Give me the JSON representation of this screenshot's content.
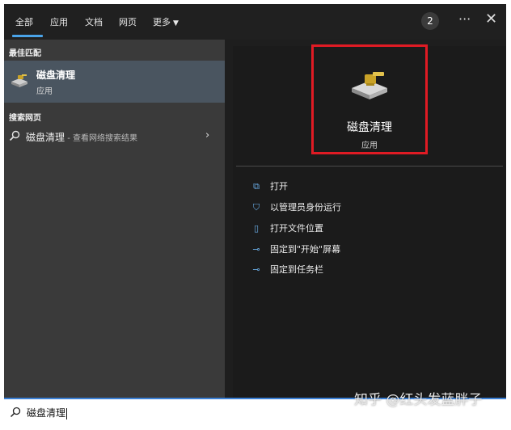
{
  "tabs": [
    {
      "label": "全部"
    },
    {
      "label": "应用"
    },
    {
      "label": "文档"
    },
    {
      "label": "网页"
    },
    {
      "label": "更多"
    }
  ],
  "header": {
    "badge": "2",
    "ellipsis": "···",
    "close": "✕"
  },
  "left": {
    "best_match_title": "最佳匹配",
    "best_match": {
      "name": "磁盘清理",
      "type": "应用",
      "icon": "disk-cleanup-icon"
    },
    "web_title": "搜索网页",
    "web_result": {
      "query": "磁盘清理",
      "suffix": " - 查看网络搜索结果",
      "chevron": "›"
    }
  },
  "right": {
    "app_name": "磁盘清理",
    "app_type": "应用",
    "actions": [
      {
        "label": "打开",
        "icon": "open-icon"
      },
      {
        "label": "以管理员身份运行",
        "icon": "shield-run-icon"
      },
      {
        "label": "打开文件位置",
        "icon": "folder-location-icon"
      },
      {
        "label": "固定到\"开始\"屏幕",
        "icon": "pin-icon"
      },
      {
        "label": "固定到任务栏",
        "icon": "pin-icon"
      }
    ]
  },
  "search": {
    "value": "磁盘清理"
  },
  "watermark": "知乎 @红头发蓝胖子",
  "colors": {
    "accent": "#4aa3e8",
    "highlight_border": "#e01b24",
    "selected_bg": "#4a5560"
  }
}
